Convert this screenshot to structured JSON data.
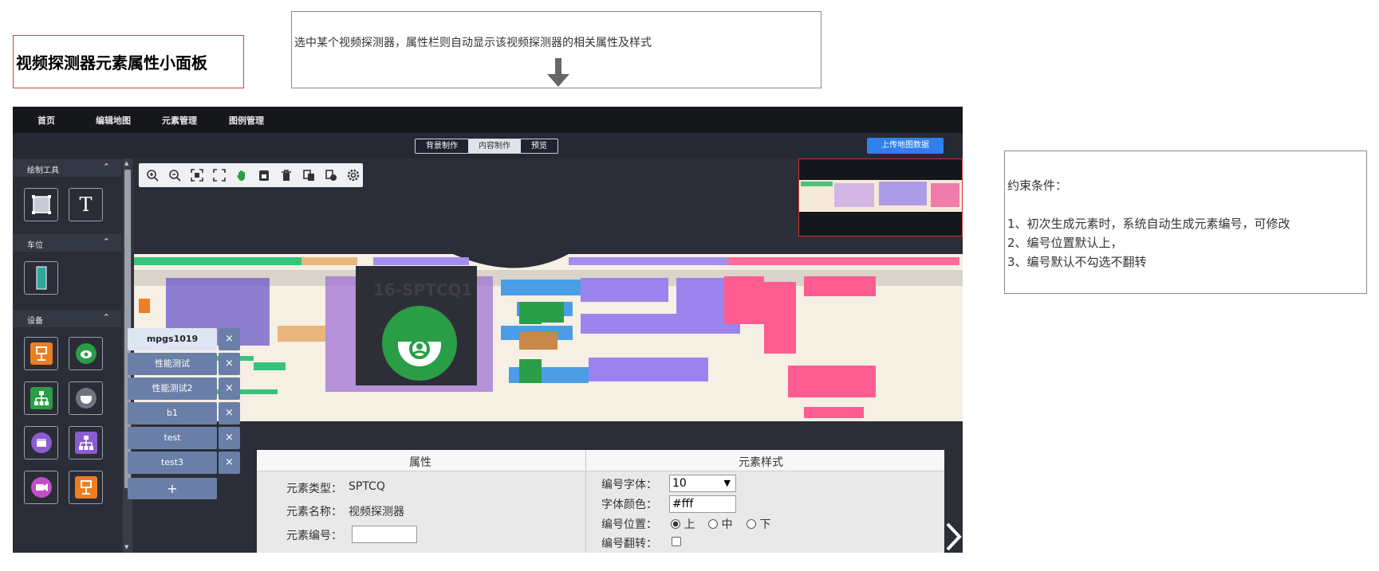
{
  "page_title": "视频探测器元素属性小面板",
  "note_top": "选中某个视频探测器，属性栏则自动显示该视频探测器的相关属性及样式",
  "note_right": {
    "heading": "约束条件：",
    "items": [
      "1、初次生成元素时，系统自动生成元素编号，可修改",
      "2、编号位置默认上，",
      "3、编号默认不勾选不翻转"
    ]
  },
  "app": {
    "nav": [
      "首页",
      "编辑地图",
      "元素管理",
      "图例管理"
    ],
    "modes": [
      "背景制作",
      "内容制作",
      "预览"
    ],
    "active_mode": "内容制作",
    "upload_label": "上传地图数据",
    "sidebar": {
      "sections": [
        "绘制工具",
        "车位",
        "设备"
      ]
    },
    "toolbar_icons": [
      "zoom-in-icon",
      "zoom-out-icon",
      "fit-icon",
      "fullscreen-icon",
      "hand-icon",
      "lock-icon",
      "trash-icon",
      "copy-icon",
      "paste-icon",
      "settings-icon"
    ],
    "canvas_label": "16-SPTCQ1",
    "tags": [
      "mpgs1019",
      "性能测试",
      "性能测试2",
      "b1",
      "test",
      "test3"
    ],
    "add_tag": "+",
    "tag_close": "×"
  },
  "properties": {
    "tab_attr": "属性",
    "tab_style": "元素样式",
    "type_label": "元素类型：",
    "type_value": "SPTCQ",
    "name_label": "元素名称：",
    "name_value": "视频探测器",
    "code_label": "元素编号：",
    "code_value": "",
    "font_label": "编号字体：",
    "font_value": "10",
    "color_label": "字体颜色：",
    "color_value": "#fff",
    "pos_label": "编号位置：",
    "pos_options": [
      "上",
      "中",
      "下"
    ],
    "pos_selected": "上",
    "flip_label": "编号翻转："
  },
  "colors": {
    "accent": "#2f80ed",
    "app_bg": "#2d3039",
    "green": "#2a9d47",
    "orange": "#ef7d22",
    "purple": "#8a5bd1",
    "pink": "#e9457a"
  }
}
